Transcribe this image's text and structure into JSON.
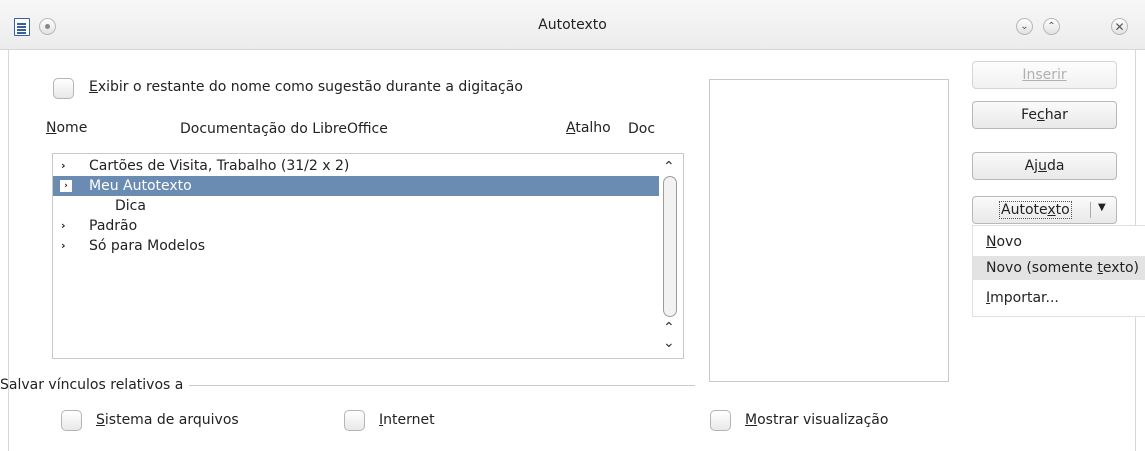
{
  "window": {
    "title": "Autotexto"
  },
  "options": {
    "show_remainder_label": "Exibir o restante do nome como sugestão durante a digitação",
    "name_label": "Nome",
    "name_value": "Documentação do LibreOffice",
    "shortcut_label": "Atalho",
    "shortcut_value": "Doc"
  },
  "tree": {
    "items": [
      {
        "label": "Cartões de Visita, Trabalho (31/2 x 2)",
        "level": 0,
        "expander": "›",
        "selected": false
      },
      {
        "label": "Meu Autotexto",
        "level": 0,
        "expander": "›",
        "selected": true
      },
      {
        "label": "Dica",
        "level": 1,
        "expander": "",
        "selected": false
      },
      {
        "label": "Padrão",
        "level": 0,
        "expander": "›",
        "selected": false
      },
      {
        "label": "Só para Modelos",
        "level": 0,
        "expander": "›",
        "selected": false
      }
    ]
  },
  "save_links": {
    "section_label": "Salvar vínculos relativos a",
    "filesystem_label": "Sistema de arquivos",
    "internet_label": "Internet"
  },
  "preview": {
    "show_preview_label": "Mostrar visualização"
  },
  "buttons": {
    "insert": "Inserir",
    "close": "Fechar",
    "help": "Ajuda",
    "autotext": "Autotexto"
  },
  "menu": {
    "items": [
      {
        "label": "Novo",
        "highlighted": false
      },
      {
        "label": "Novo (somente texto)",
        "highlighted": true
      },
      {
        "label": "Importar...",
        "highlighted": false
      }
    ]
  },
  "colors": {
    "selection": "#6b8cb2",
    "menu_highlight": "#e3e3e3"
  }
}
